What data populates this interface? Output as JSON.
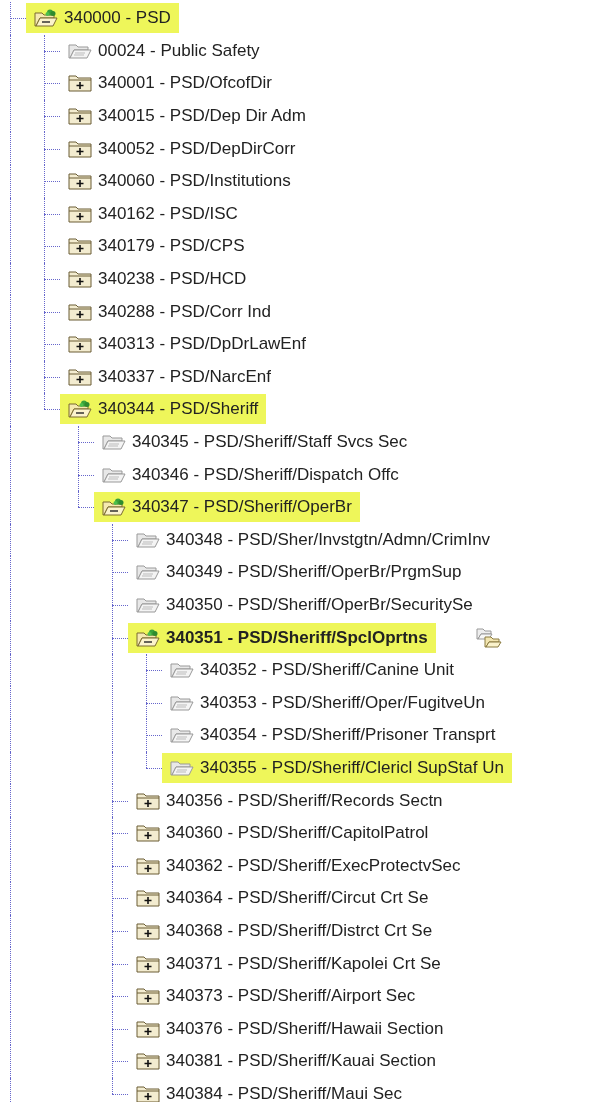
{
  "tree": [
    {
      "label": "340000 - PSD",
      "kind": "expanded",
      "highlighted": true,
      "bold": false,
      "children": [
        {
          "label": "00024 - Public Safety",
          "kind": "leaf",
          "highlighted": false,
          "bold": false
        },
        {
          "label": "340001 - PSD/OfcofDir",
          "kind": "collapsed",
          "highlighted": false,
          "bold": false
        },
        {
          "label": "340015 - PSD/Dep Dir Adm",
          "kind": "collapsed",
          "highlighted": false,
          "bold": false
        },
        {
          "label": "340052 - PSD/DepDirCorr",
          "kind": "collapsed",
          "highlighted": false,
          "bold": false
        },
        {
          "label": "340060 - PSD/Institutions",
          "kind": "collapsed",
          "highlighted": false,
          "bold": false
        },
        {
          "label": "340162 - PSD/ISC",
          "kind": "collapsed",
          "highlighted": false,
          "bold": false
        },
        {
          "label": "340179 - PSD/CPS",
          "kind": "collapsed",
          "highlighted": false,
          "bold": false
        },
        {
          "label": "340238 - PSD/HCD",
          "kind": "collapsed",
          "highlighted": false,
          "bold": false
        },
        {
          "label": "340288 - PSD/Corr Ind",
          "kind": "collapsed",
          "highlighted": false,
          "bold": false
        },
        {
          "label": "340313 - PSD/DpDrLawEnf",
          "kind": "collapsed",
          "highlighted": false,
          "bold": false
        },
        {
          "label": "340337 - PSD/NarcEnf",
          "kind": "collapsed",
          "highlighted": false,
          "bold": false
        },
        {
          "label": "340344 - PSD/Sheriff",
          "kind": "expanded",
          "highlighted": true,
          "bold": false,
          "children": [
            {
              "label": "340345 - PSD/Sheriff/Staff Svcs Sec",
              "kind": "leaf",
              "highlighted": false,
              "bold": false
            },
            {
              "label": "340346 - PSD/Sheriff/Dispatch Offc",
              "kind": "leaf",
              "highlighted": false,
              "bold": false
            },
            {
              "label": "340347 - PSD/Sheriff/OperBr",
              "kind": "expanded",
              "highlighted": true,
              "bold": false,
              "children": [
                {
                  "label": "340348 - PSD/Sher/Invstgtn/Admn/CrimInv",
                  "kind": "leaf",
                  "highlighted": false,
                  "bold": false
                },
                {
                  "label": "340349 - PSD/Sheriff/OperBr/PrgmSup",
                  "kind": "leaf",
                  "highlighted": false,
                  "bold": false
                },
                {
                  "label": "340350 - PSD/Sheriff/OperBr/SecuritySe",
                  "kind": "leaf",
                  "highlighted": false,
                  "bold": false
                },
                {
                  "label": "340351 - PSD/Sheriff/SpclOprtns",
                  "kind": "expanded",
                  "highlighted": true,
                  "bold": true,
                  "move_icon": true,
                  "children": [
                    {
                      "label": "340352 - PSD/Sheriff/Canine Unit",
                      "kind": "leaf",
                      "highlighted": false,
                      "bold": false
                    },
                    {
                      "label": "340353 - PSD/Sheriff/Oper/FugitveUn",
                      "kind": "leaf",
                      "highlighted": false,
                      "bold": false
                    },
                    {
                      "label": "340354 - PSD/Sheriff/Prisoner Transprt",
                      "kind": "leaf",
                      "highlighted": false,
                      "bold": false
                    },
                    {
                      "label": "340355 - PSD/Sheriff/Clericl SupStaf Un",
                      "kind": "leaf",
                      "highlighted": true,
                      "bold": false
                    }
                  ]
                },
                {
                  "label": "340356 - PSD/Sheriff/Records Sectn",
                  "kind": "collapsed",
                  "highlighted": false,
                  "bold": false
                },
                {
                  "label": "340360 - PSD/Sheriff/CapitolPatrol",
                  "kind": "collapsed",
                  "highlighted": false,
                  "bold": false
                },
                {
                  "label": "340362 - PSD/Sheriff/ExecProtectvSec",
                  "kind": "collapsed",
                  "highlighted": false,
                  "bold": false
                },
                {
                  "label": "340364 - PSD/Sheriff/Circut Crt Se",
                  "kind": "collapsed",
                  "highlighted": false,
                  "bold": false
                },
                {
                  "label": "340368 - PSD/Sheriff/Distrct Crt Se",
                  "kind": "collapsed",
                  "highlighted": false,
                  "bold": false
                },
                {
                  "label": "340371 - PSD/Sheriff/Kapolei Crt Se",
                  "kind": "collapsed",
                  "highlighted": false,
                  "bold": false
                },
                {
                  "label": "340373 - PSD/Sheriff/Airport Sec",
                  "kind": "collapsed",
                  "highlighted": false,
                  "bold": false
                },
                {
                  "label": "340376 - PSD/Sheriff/Hawaii Section",
                  "kind": "collapsed",
                  "highlighted": false,
                  "bold": false
                },
                {
                  "label": "340381 - PSD/Sheriff/Kauai Section",
                  "kind": "collapsed",
                  "highlighted": false,
                  "bold": false
                },
                {
                  "label": "340384 - PSD/Sheriff/Maui Sec",
                  "kind": "collapsed",
                  "highlighted": false,
                  "bold": false
                }
              ]
            }
          ]
        }
      ]
    }
  ]
}
